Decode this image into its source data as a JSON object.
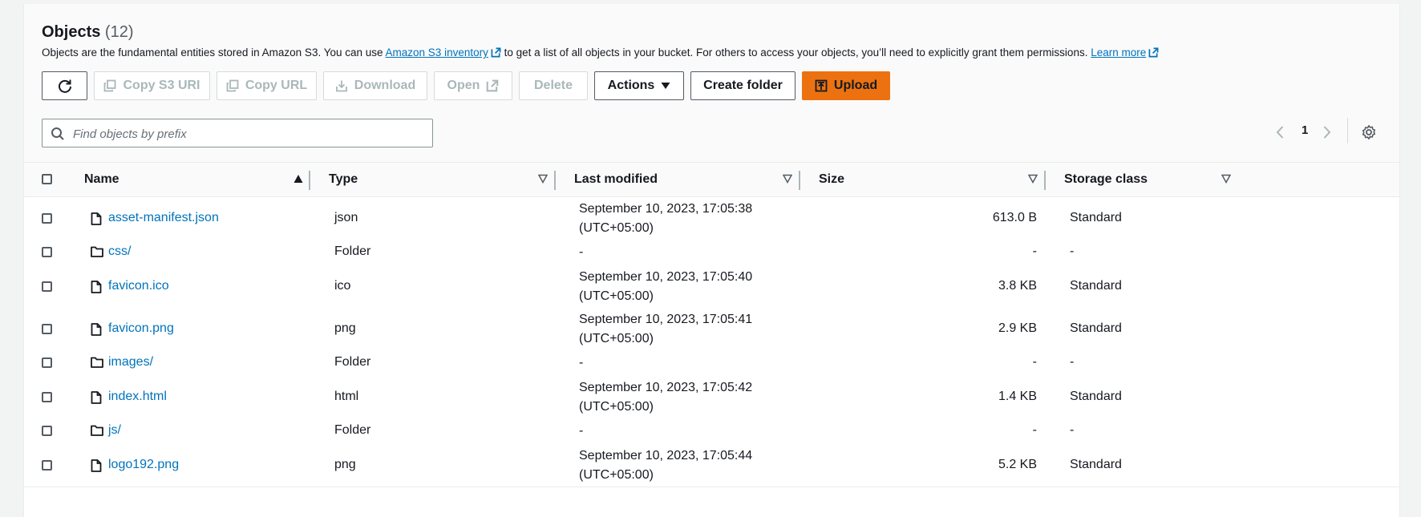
{
  "header": {
    "title": "Objects",
    "count": "(12)",
    "desc_part1": "Objects are the fundamental entities stored in Amazon S3. You can use ",
    "inventory_link": "Amazon S3 inventory",
    "desc_part2": " to get a list of all objects in your bucket. For others to access your objects, you’ll need to explicitly grant them permissions. ",
    "learn_more": "Learn more"
  },
  "toolbar": {
    "copy_s3_uri": "Copy S3 URI",
    "copy_url": "Copy URL",
    "download": "Download",
    "open": "Open",
    "delete": "Delete",
    "actions": "Actions",
    "create_folder": "Create folder",
    "upload": "Upload"
  },
  "search": {
    "placeholder": "Find objects by prefix",
    "value": ""
  },
  "pagination": {
    "current_page": "1"
  },
  "columns": {
    "name": "Name",
    "type": "Type",
    "last_modified": "Last modified",
    "size": "Size",
    "storage_class": "Storage class"
  },
  "rows": [
    {
      "name": "asset-manifest.json",
      "kind": "file",
      "type": "json",
      "modified_date": "September 10, 2023, 17:05:38",
      "modified_tz": "(UTC+05:00)",
      "size": "613.0 B",
      "storage_class": "Standard"
    },
    {
      "name": "css/",
      "kind": "folder",
      "type": "Folder",
      "modified_date": "-",
      "modified_tz": "",
      "size": "-",
      "storage_class": "-"
    },
    {
      "name": "favicon.ico",
      "kind": "file",
      "type": "ico",
      "modified_date": "September 10, 2023, 17:05:40",
      "modified_tz": "(UTC+05:00)",
      "size": "3.8 KB",
      "storage_class": "Standard"
    },
    {
      "name": "favicon.png",
      "kind": "file",
      "type": "png",
      "modified_date": "September 10, 2023, 17:05:41",
      "modified_tz": "(UTC+05:00)",
      "size": "2.9 KB",
      "storage_class": "Standard"
    },
    {
      "name": "images/",
      "kind": "folder",
      "type": "Folder",
      "modified_date": "-",
      "modified_tz": "",
      "size": "-",
      "storage_class": "-"
    },
    {
      "name": "index.html",
      "kind": "file",
      "type": "html",
      "modified_date": "September 10, 2023, 17:05:42",
      "modified_tz": "(UTC+05:00)",
      "size": "1.4 KB",
      "storage_class": "Standard"
    },
    {
      "name": "js/",
      "kind": "folder",
      "type": "Folder",
      "modified_date": "-",
      "modified_tz": "",
      "size": "-",
      "storage_class": "-"
    },
    {
      "name": "logo192.png",
      "kind": "file",
      "type": "png",
      "modified_date": "September 10, 2023, 17:05:44",
      "modified_tz": "(UTC+05:00)",
      "size": "5.2 KB",
      "storage_class": "Standard"
    }
  ],
  "colors": {
    "link": "#0073bb",
    "primary": "#ec7211",
    "border": "#aab7b8"
  }
}
